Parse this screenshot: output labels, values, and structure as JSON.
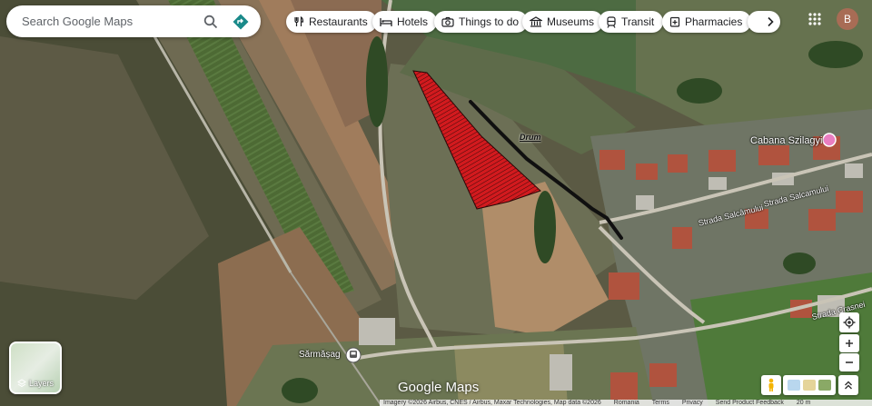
{
  "search": {
    "placeholder": "Search Google Maps"
  },
  "categories": [
    {
      "label": "Restaurants",
      "icon": "fork-knife-icon"
    },
    {
      "label": "Hotels",
      "icon": "bed-icon"
    },
    {
      "label": "Things to do",
      "icon": "camera-icon"
    },
    {
      "label": "Museums",
      "icon": "museum-icon"
    },
    {
      "label": "Transit",
      "icon": "train-icon"
    },
    {
      "label": "Pharmacies",
      "icon": "pharmacy-icon"
    }
  ],
  "account": {
    "initial": "B"
  },
  "map_labels": {
    "drum": "Drum",
    "cabana": "Cabana Szilagyi",
    "salcamului_1": "Strada Salcamului",
    "salcamului_2": "Strada Salcâmului",
    "crasnei": "Strada Crasnei",
    "sarmasag": "Sărmășag"
  },
  "layers": {
    "label": "Layers"
  },
  "logo": "Google Maps",
  "attribution": {
    "imagery": "Imagery ©2026 Airbus, CNES / Airbus, Maxar Technologies, Map data ©2026",
    "links": [
      "Romania",
      "Terms",
      "Privacy",
      "Send Product Feedback"
    ],
    "scale": "20 m"
  },
  "colors": {
    "annotation_red": "#e0161b",
    "annotation_black": "#101010",
    "accent_blue": "#1a73e8"
  }
}
